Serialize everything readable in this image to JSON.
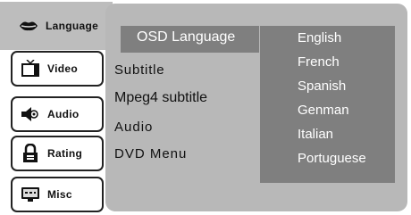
{
  "sidebar": {
    "tabs": [
      {
        "label": "Language",
        "icon": "lips-icon"
      },
      {
        "label": "Video",
        "icon": "tv-icon"
      },
      {
        "label": "Audio",
        "icon": "speaker-icon"
      },
      {
        "label": "Rating",
        "icon": "padlock-icon"
      },
      {
        "label": "Misc",
        "icon": "monitor-icon"
      }
    ]
  },
  "menu": {
    "selected": "OSD Language",
    "items": [
      "Subtitle",
      "Mpeg4 subtitle",
      "Audio",
      "DVD Menu"
    ]
  },
  "options": [
    "English",
    "French",
    "Spanish",
    "Genman",
    "Italian",
    "Portuguese"
  ],
  "colors": {
    "panel": "#b8b8b8",
    "highlight": "#7f7f7f",
    "active_tab": "#bdbdbd"
  }
}
